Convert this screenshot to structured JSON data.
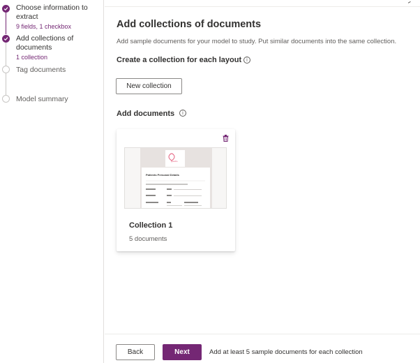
{
  "steps": [
    {
      "label": "Choose information to extract",
      "sub": "9 fields, 1 checkbox",
      "state": "done"
    },
    {
      "label": "Add collections of documents",
      "sub": "1 collection",
      "state": "current"
    },
    {
      "label": "Tag documents",
      "sub": "",
      "state": "todo"
    },
    {
      "label": "Model summary",
      "sub": "",
      "state": "todo"
    }
  ],
  "main": {
    "title": "Add collections of documents",
    "description": "Add sample documents for your model to study. Put similar documents into the same collection.",
    "create_heading": "Create a collection for each layout",
    "new_collection_label": "New collection",
    "add_documents_heading": "Add documents"
  },
  "collection": {
    "name": "Collection 1",
    "count": "5 documents",
    "thumb_logo": "ppleRo",
    "thumb_heading": "Patients Personal Details"
  },
  "footer": {
    "back_label": "Back",
    "next_label": "Next",
    "note": "Add at least 5 sample documents for each collection"
  },
  "colors": {
    "accent": "#742774",
    "border": "#8a8886",
    "text": "#323130"
  }
}
